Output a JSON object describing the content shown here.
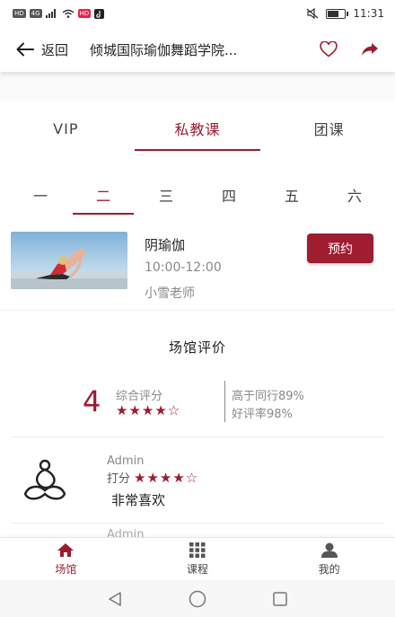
{
  "status_bar": {
    "left_chips": [
      "HD",
      "4G",
      "HD"
    ],
    "time": "11:31"
  },
  "nav": {
    "back_label": "返回",
    "title": "倾城国际瑜伽舞蹈学院..."
  },
  "tabs": [
    {
      "label": "VIP",
      "active": false
    },
    {
      "label": "私教课",
      "active": true
    },
    {
      "label": "团课",
      "active": false
    }
  ],
  "days": [
    {
      "label": "一",
      "active": false
    },
    {
      "label": "二",
      "active": true
    },
    {
      "label": "三",
      "active": false
    },
    {
      "label": "四",
      "active": false
    },
    {
      "label": "五",
      "active": false
    },
    {
      "label": "六",
      "active": false
    }
  ],
  "course": {
    "name": "阴瑜伽",
    "time": "10:00-12:00",
    "teacher": "小雪老师",
    "book_label": "预约"
  },
  "reviews": {
    "title": "场馆评价",
    "score": "4",
    "score_label": "综合评分",
    "stars": "★★★★☆",
    "stat_higher": "高于同行89%",
    "stat_good": "好评率98%",
    "items": [
      {
        "user": "Admin",
        "score_label": "打分",
        "stars": "★★★★☆",
        "text": "非常喜欢"
      },
      {
        "user": "Admin"
      }
    ]
  },
  "bottom_nav": [
    {
      "label": "场馆",
      "icon": "home-icon",
      "active": true
    },
    {
      "label": "课程",
      "icon": "grid-icon",
      "active": false
    },
    {
      "label": "我的",
      "icon": "user-icon",
      "active": false
    }
  ],
  "colors": {
    "accent": "#9b1c30",
    "button": "#a01c30"
  }
}
